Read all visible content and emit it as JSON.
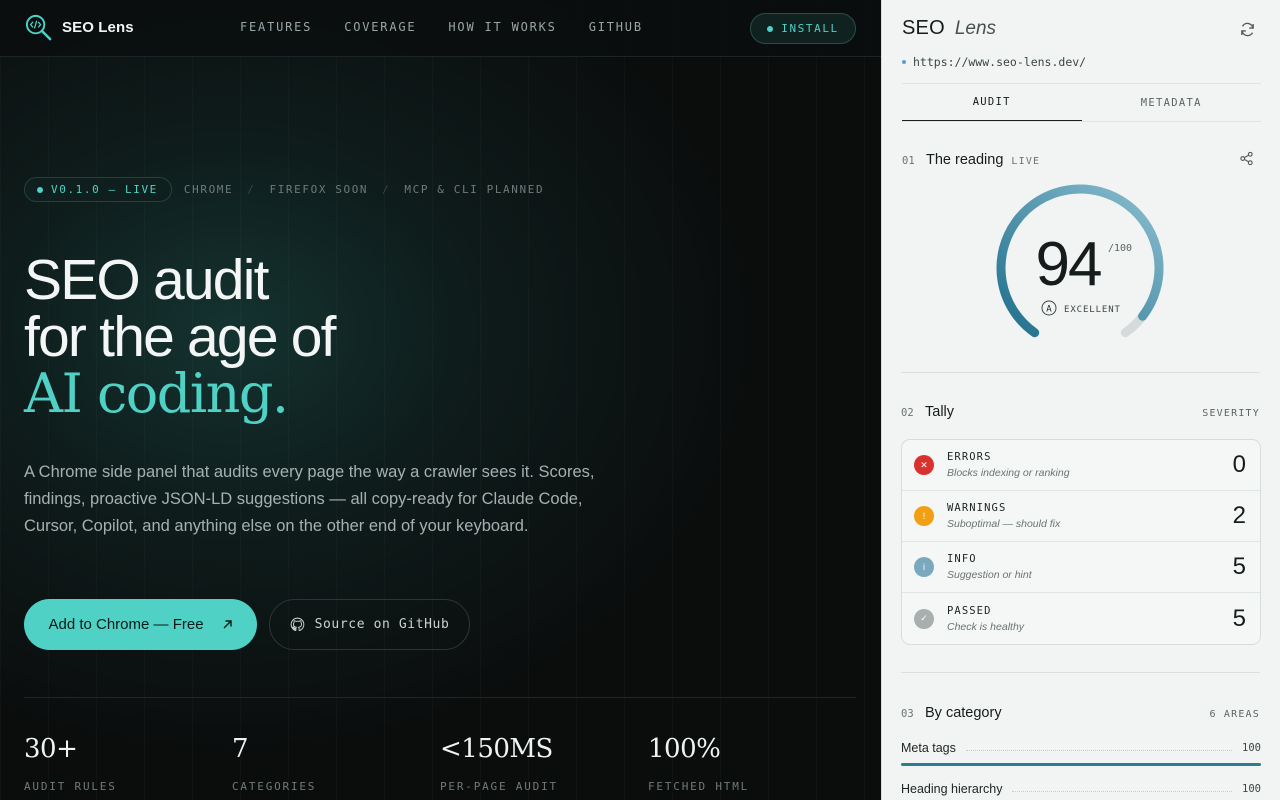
{
  "site": {
    "brand": "SEO Lens",
    "nav": [
      "FEATURES",
      "COVERAGE",
      "HOW IT WORKS",
      "GITHUB"
    ],
    "install_label": "INSTALL",
    "version_badge": "V0.1.0 — LIVE",
    "platforms": [
      "CHROME",
      "FIREFOX SOON",
      "MCP & CLI PLANNED"
    ],
    "platform_separator": "/",
    "hero_line1": "SEO audit",
    "hero_line2": "for the age of",
    "hero_accent": "AI coding.",
    "lede": "A Chrome side panel that audits every page the way a crawler sees it. Scores, findings, proactive JSON-LD suggestions — all copy-ready for Claude Code, Cursor, Copilot, and anything else on the other end of your keyboard.",
    "cta_primary": "Add to Chrome — Free",
    "cta_secondary": "Source on GitHub",
    "stats": [
      {
        "value": "30+",
        "label": "AUDIT RULES"
      },
      {
        "value": "7",
        "label": "CATEGORIES"
      },
      {
        "value": "<150MS",
        "label": "PER-PAGE AUDIT"
      },
      {
        "value": "100%",
        "label": "FETCHED HTML"
      }
    ]
  },
  "panel": {
    "title": "SEO",
    "title_italic": "Lens",
    "url": "https://www.seo-lens.dev/",
    "tabs": [
      "AUDIT",
      "METADATA"
    ],
    "active_tab": "AUDIT",
    "reading": {
      "num": "01",
      "title": "The reading",
      "tag": "LIVE",
      "score": 94,
      "score_display": "94",
      "max": "/100",
      "grade": "A",
      "grade_label": "EXCELLENT"
    },
    "tally": {
      "num": "02",
      "title": "Tally",
      "right": "SEVERITY",
      "rows": [
        {
          "name": "ERRORS",
          "desc": "Blocks indexing or ranking",
          "count": "0",
          "icon": "error-x-icon",
          "color": "#d9322e",
          "glyph": "✕"
        },
        {
          "name": "WARNINGS",
          "desc": "Suboptimal — should fix",
          "count": "2",
          "icon": "warning-icon",
          "color": "#f0a012",
          "glyph": "!"
        },
        {
          "name": "INFO",
          "desc": "Suggestion or hint",
          "count": "5",
          "icon": "info-icon",
          "color": "#7aa9be",
          "glyph": "i"
        },
        {
          "name": "PASSED",
          "desc": "Check is healthy",
          "count": "5",
          "icon": "check-icon",
          "color": "#a9afaf",
          "glyph": "✓"
        }
      ]
    },
    "category": {
      "num": "03",
      "title": "By category",
      "right": "6 AREAS",
      "rows": [
        {
          "name": "Meta tags",
          "value": "100"
        },
        {
          "name": "Heading hierarchy",
          "value": "100"
        }
      ]
    }
  }
}
